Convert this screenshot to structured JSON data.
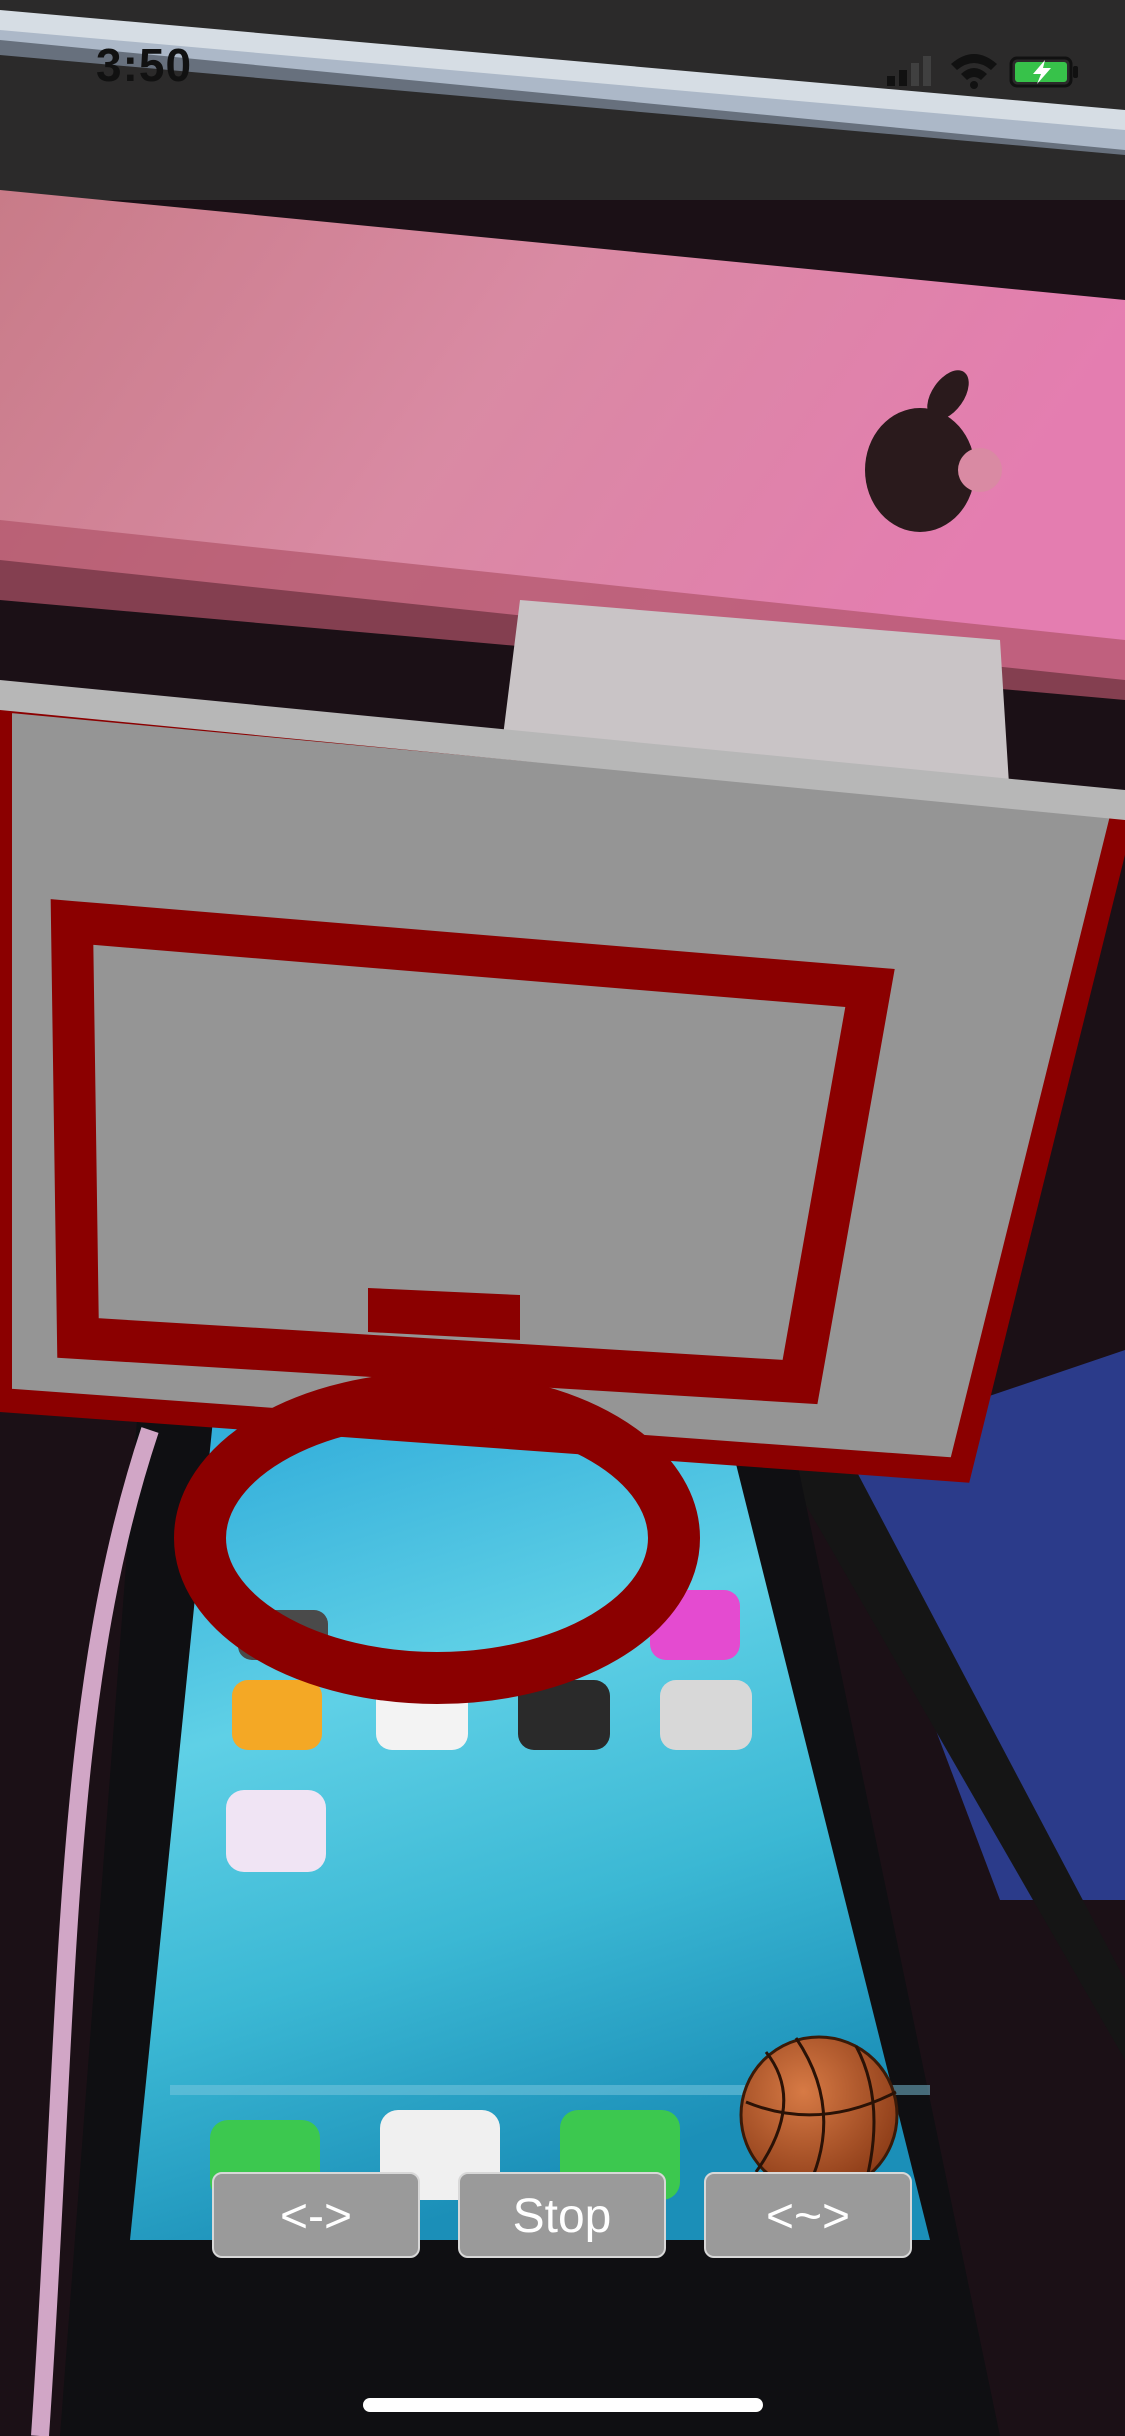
{
  "status_bar": {
    "time": "3:50"
  },
  "controls": {
    "left_label": "<->",
    "stop_label": "Stop",
    "right_label": "<~>"
  },
  "colors": {
    "hoop_red": "#8b0000",
    "backboard_gray": "#959595",
    "button_gray": "#9a9a9a"
  },
  "icons": [
    "signal-icon",
    "wifi-icon",
    "battery-charging-icon",
    "basketball-icon"
  ]
}
